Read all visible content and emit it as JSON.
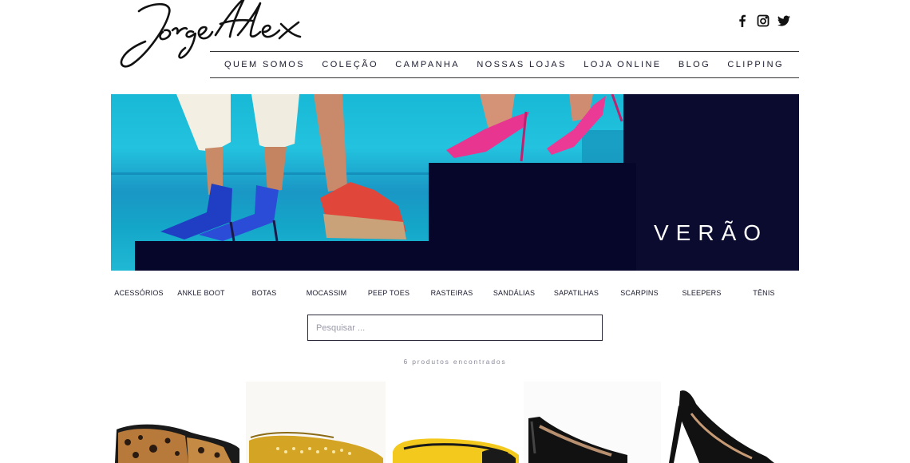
{
  "brand": {
    "logo_text": "Jorge Alex"
  },
  "social": [
    {
      "icon": "facebook-icon"
    },
    {
      "icon": "instagram-icon"
    },
    {
      "icon": "twitter-icon"
    }
  ],
  "main_nav": {
    "items": [
      {
        "label": "QUEM SOMOS"
      },
      {
        "label": "COLEÇÃO"
      },
      {
        "label": "CAMPANHA"
      },
      {
        "label": "NOSSAS LOJAS"
      },
      {
        "label": "LOJA ONLINE"
      },
      {
        "label": "BLOG"
      },
      {
        "label": "CLIPPING"
      }
    ]
  },
  "hero": {
    "title": "VERÃO"
  },
  "categories": [
    {
      "label": "ACESSÓRIOS"
    },
    {
      "label": "ANKLE BOOT"
    },
    {
      "label": "BOTAS"
    },
    {
      "label": "MOCASSIM"
    },
    {
      "label": "PEEP TOES"
    },
    {
      "label": "RASTEIRAS"
    },
    {
      "label": "SANDÁLIAS"
    },
    {
      "label": "SAPATILHAS"
    },
    {
      "label": "SCARPINS"
    },
    {
      "label": "SLEEPERS"
    },
    {
      "label": "TÊNIS"
    }
  ],
  "search": {
    "placeholder": "Pesquisar ...",
    "value": ""
  },
  "results": {
    "count_text": "6 produtos encontrados"
  },
  "colors": {
    "navy": "#0b0b30",
    "sea": "#1fb8d4",
    "text": "#1a1a2e"
  }
}
